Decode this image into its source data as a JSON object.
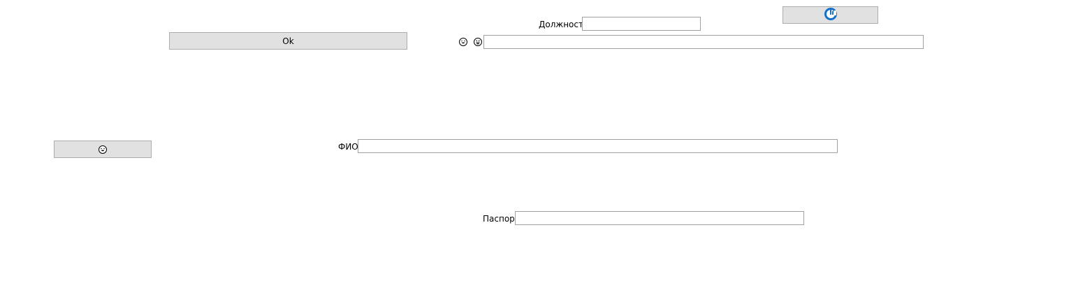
{
  "buttons": {
    "ok_label": "Ok",
    "top_right_icon": "refresh-circle-icon",
    "left_icon": "grinning-face-icon"
  },
  "fields": {
    "position": {
      "label": "Должность",
      "value": ""
    },
    "emoji_field": {
      "value": "",
      "icons": [
        "laughing-face-icon",
        "grinning-face-icon"
      ]
    },
    "fio": {
      "label": "ФИО",
      "value": ""
    },
    "passport": {
      "label": "Паспорт",
      "value": ""
    }
  },
  "colors": {
    "button_bg": "#e1e1e1",
    "button_border": "#adadad",
    "field_border": "#a0a0a0",
    "accent_blue": "#1570c8"
  }
}
